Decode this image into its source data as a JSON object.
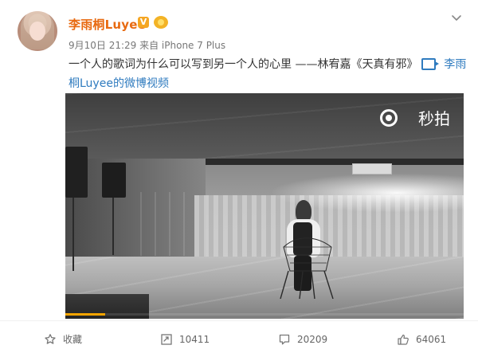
{
  "post": {
    "author": "李雨桐Luyee",
    "verified_label": "V",
    "level_badge": "",
    "time_source": "9月10日 21:29 来自 iPhone 7 Plus",
    "text": "一个人的歌词为什么可以写到另一个人的心里 ——林宥嘉《天真有邪》",
    "video_link_text": "李雨桐Luyee的微博视频"
  },
  "video": {
    "watermark": "秒拍",
    "progress": 0.1
  },
  "actions": {
    "save_label": "收藏",
    "forward_count": "10411",
    "comment_count": "20209",
    "like_count": "64061"
  },
  "icons": {
    "menu": "chevron-down-icon",
    "save": "star-icon",
    "forward": "forward-icon",
    "comment": "comment-icon",
    "like": "thumb-up-icon"
  },
  "colors": {
    "username": "#e86a11",
    "link": "#2f7bbf",
    "badge": "#f5a623",
    "progress": "#f7a500"
  }
}
